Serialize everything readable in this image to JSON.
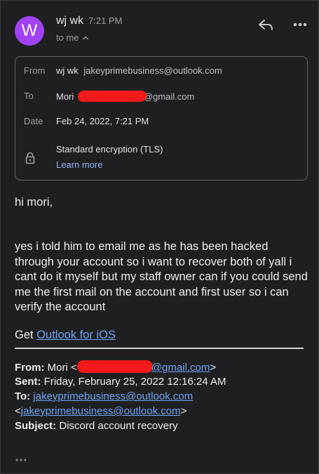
{
  "header": {
    "avatar_letter": "W",
    "sender_name": "wj wk",
    "time": "7:21 PM",
    "to_label": "to me"
  },
  "details": {
    "from_label": "From",
    "from_name": "wj wk",
    "from_email": "jakeyprimebusiness@outlook.com",
    "to_label": "To",
    "to_name": "Mori",
    "to_email_suffix": "@gmail.com",
    "date_label": "Date",
    "date_value": "Feb 24, 2022, 7:21 PM",
    "encryption": "Standard encryption (TLS)",
    "learn_more": "Learn more"
  },
  "message": {
    "greeting": "hi mori,",
    "body": "yes i told him to email me as he has been hacked through your account so i want to recover both of yall i cant do it myself but my staff owner can if you could send me the first mail on the account and first user so i can verify the account",
    "get_prefix": "Get",
    "get_link": "Outlook for iOS"
  },
  "quoted": {
    "from_label": "From:",
    "from_name": "Mori <",
    "from_email_suffix": "@gmail.com",
    "from_close": ">",
    "sent_label": "Sent:",
    "sent_value": "Friday, February 25, 2022 12:16:24 AM",
    "to_label": "To:",
    "to_email": "jakeyprimebusiness@outlook.com",
    "to_open": "<",
    "to_email2": "jakeyprimebusiness@outlook.com",
    "to_close": ">",
    "subject_label": "Subject:",
    "subject_value": "Discord account recovery"
  },
  "colors": {
    "background": "#1f1f21",
    "avatar": "#a142f4",
    "link": "#8ab4f8",
    "redaction": "#f21a1a"
  },
  "icons": [
    "reply-icon",
    "more-horiz-icon",
    "chevron-up-icon",
    "lock-icon",
    "trimmed-content-icon"
  ]
}
